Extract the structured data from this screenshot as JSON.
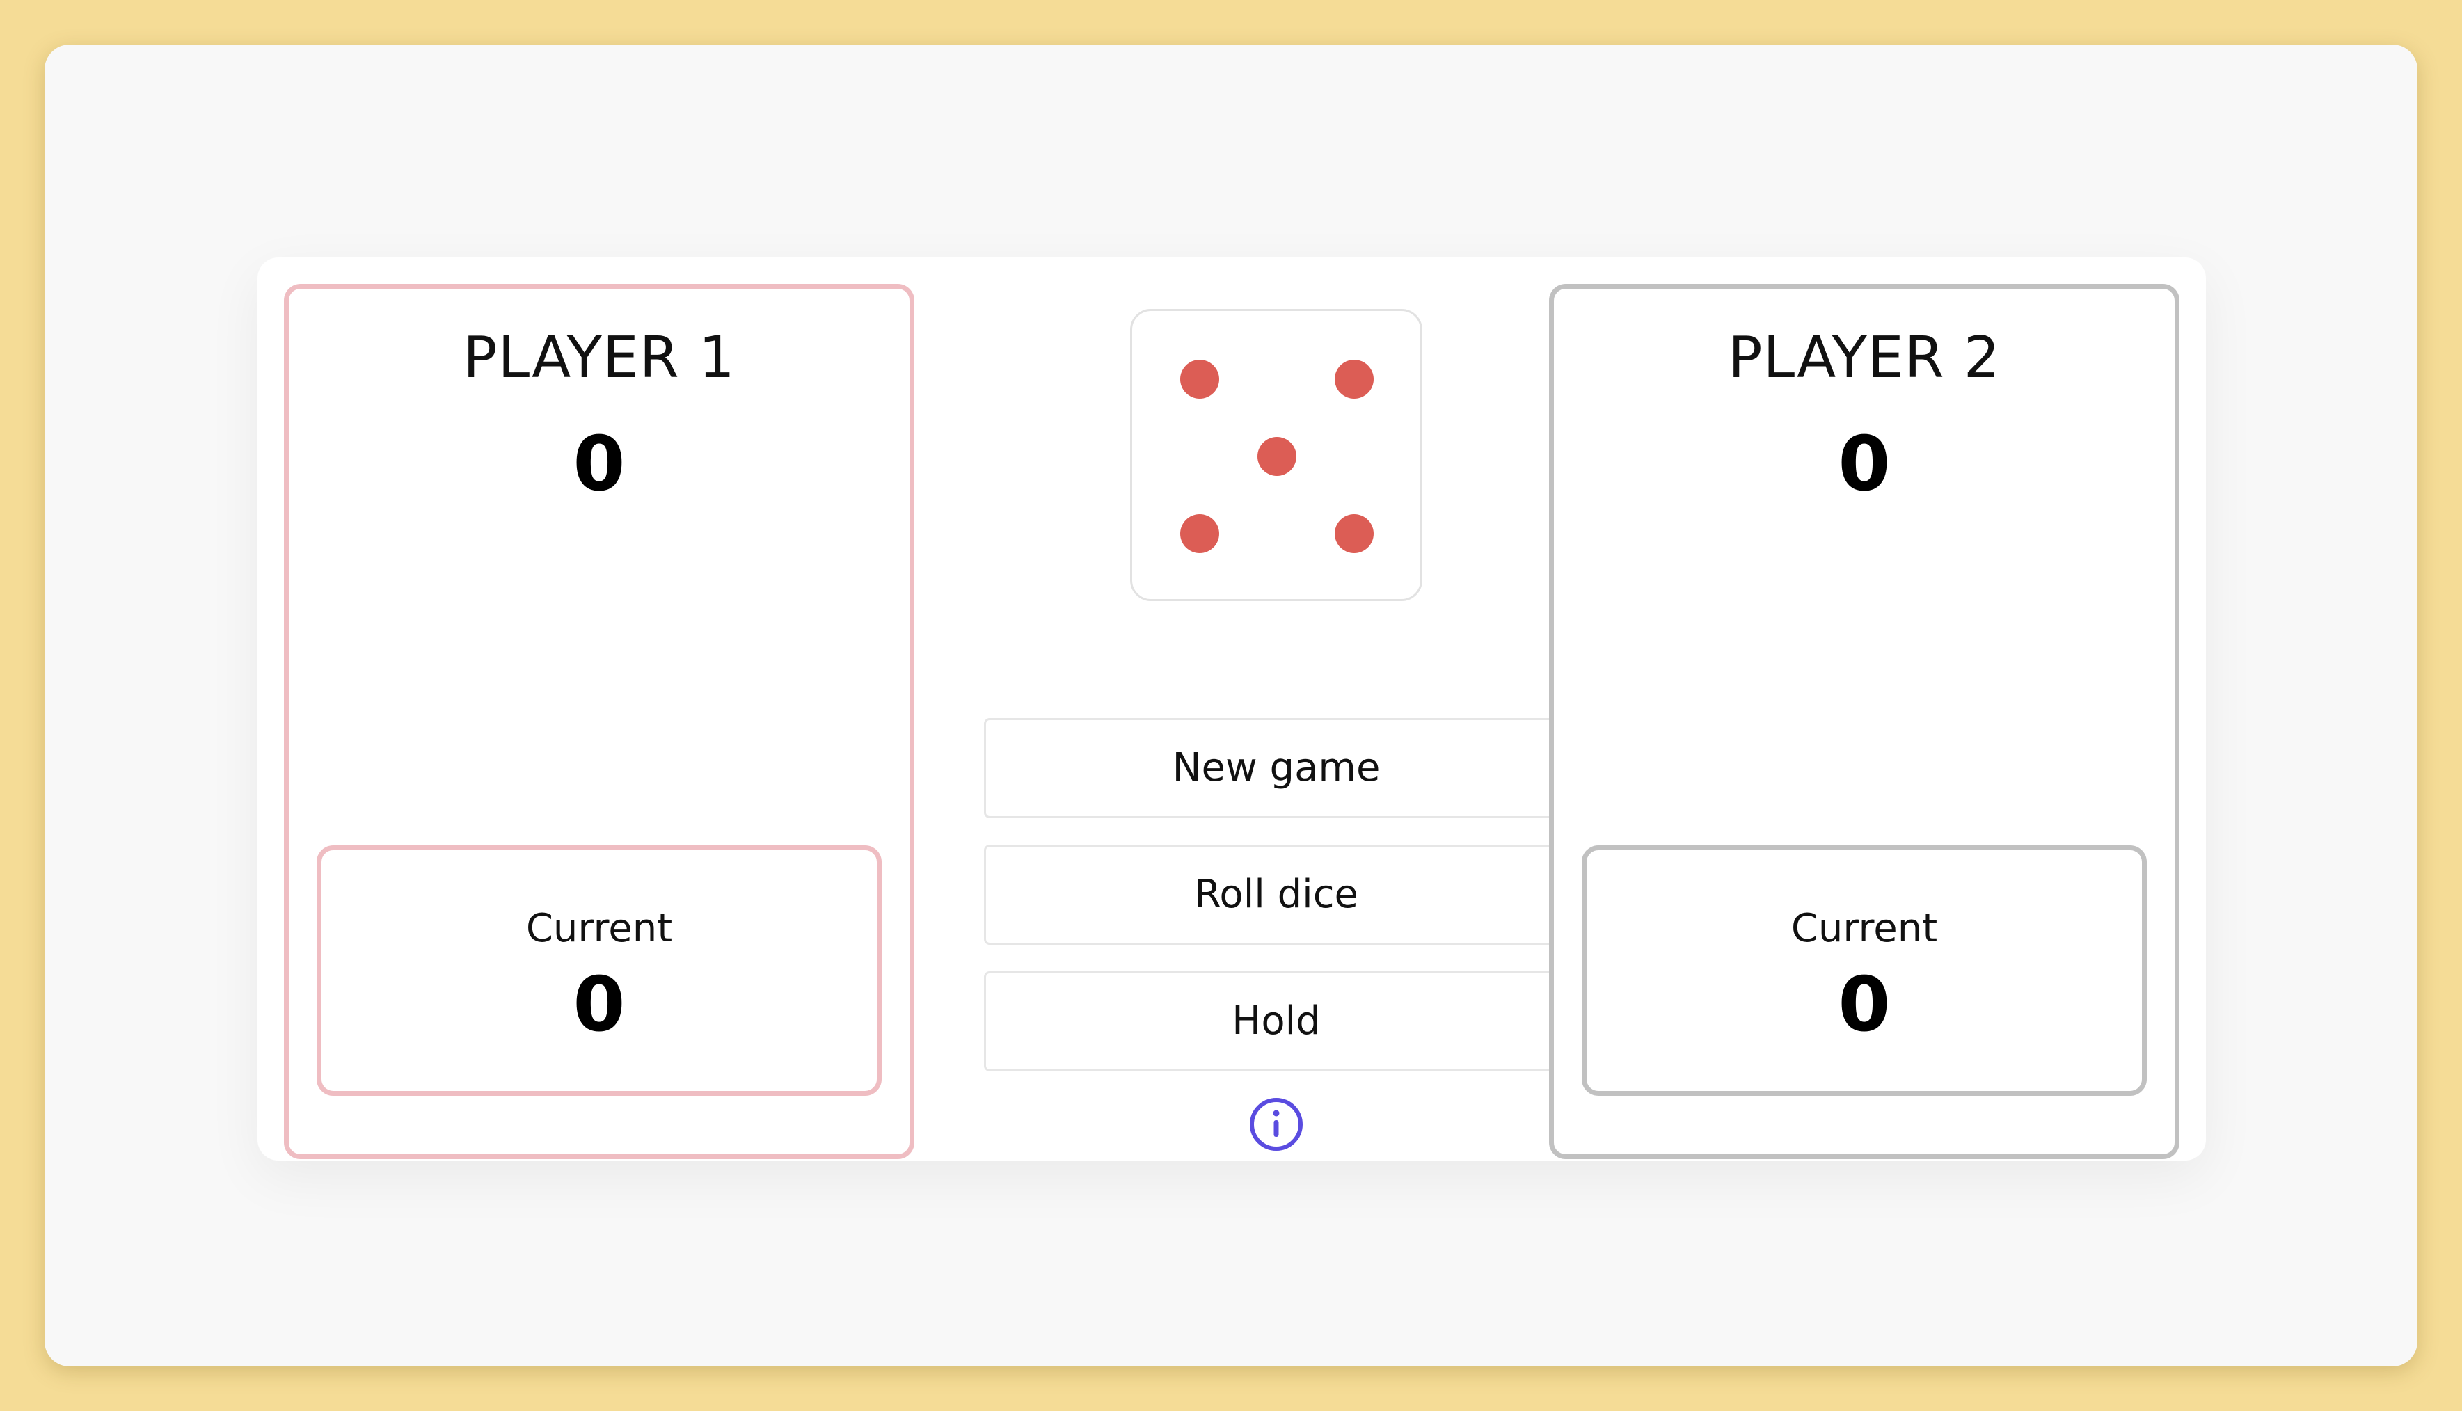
{
  "players": [
    {
      "name": "PLAYER 1",
      "score": "0",
      "current_label": "Current",
      "current_score": "0",
      "active": true
    },
    {
      "name": "PLAYER 2",
      "score": "0",
      "current_label": "Current",
      "current_score": "0",
      "active": false
    }
  ],
  "dice": {
    "value": 5,
    "pip_color": "#dc5d55"
  },
  "controls": {
    "new_game": "New game",
    "roll_dice": "Roll dice",
    "hold": "Hold",
    "info_icon": "info-icon"
  },
  "colors": {
    "background": "#f5dc96",
    "active_border": "#efbdc2",
    "inactive_border": "#c1c1c1",
    "info_accent": "#5a4ce0"
  }
}
